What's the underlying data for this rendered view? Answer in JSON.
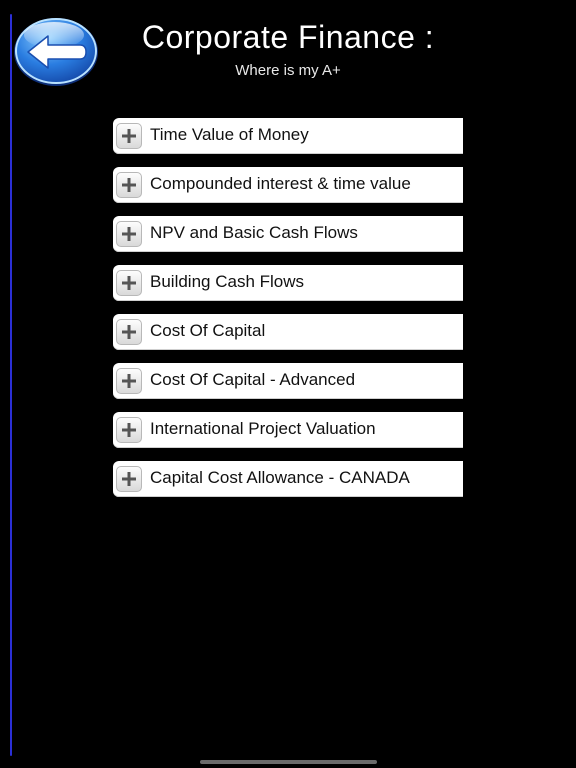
{
  "header": {
    "title": "Corporate Finance :",
    "subtitle": "Where is my A+"
  },
  "back_button": {
    "icon": "arrow-left-icon",
    "color": "#2a7de1"
  },
  "menu": {
    "items": [
      {
        "label": "Time Value of Money",
        "icon": "plus-icon"
      },
      {
        "label": "Compounded interest & time value",
        "icon": "plus-icon"
      },
      {
        "label": "NPV and Basic Cash Flows",
        "icon": "plus-icon"
      },
      {
        "label": "Building Cash Flows",
        "icon": "plus-icon"
      },
      {
        "label": "Cost Of Capital",
        "icon": "plus-icon"
      },
      {
        "label": "Cost Of Capital - Advanced",
        "icon": "plus-icon"
      },
      {
        "label": "International Project Valuation",
        "icon": "plus-icon"
      },
      {
        "label": "Capital Cost Allowance - CANADA",
        "icon": "plus-icon"
      }
    ]
  },
  "colors": {
    "background": "#000000",
    "side_line": "#2b2fd6",
    "item_background": "#ffffff"
  }
}
